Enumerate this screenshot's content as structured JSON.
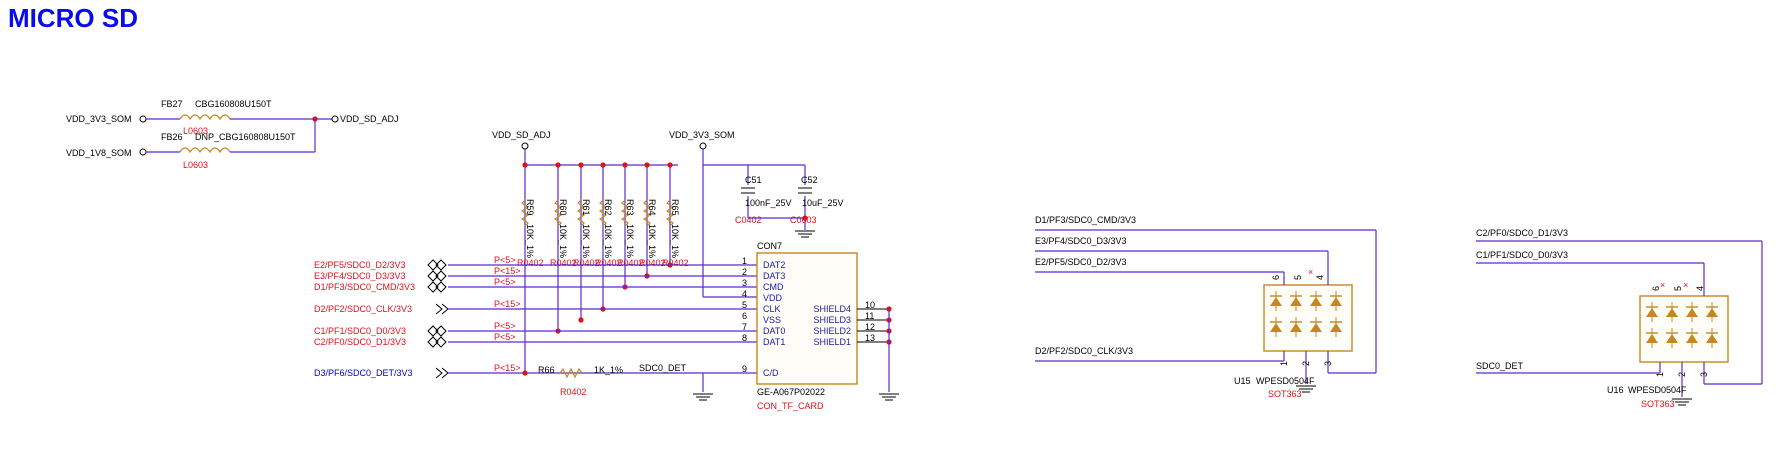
{
  "title": "MICRO SD",
  "ferrites": {
    "fb27": {
      "ref": "FB27",
      "value": "CBG160808U150T",
      "pkg": "L0603"
    },
    "fb26": {
      "ref": "FB26",
      "value": "DNP_CBG160808U150T",
      "pkg": "L0603"
    }
  },
  "power": {
    "vdd_3v3_som": "VDD_3V3_SOM",
    "vdd_1v8_som": "VDD_1V8_SOM",
    "vdd_sd_adj": "VDD_SD_ADJ",
    "vdd_sd_adj_top": "VDD_SD_ADJ",
    "vdd_3v3_som_top": "VDD_3V3_SOM"
  },
  "resistors": [
    {
      "ref": "R59",
      "value": "10K_1%",
      "pkg": "R0402"
    },
    {
      "ref": "R60",
      "value": "10K_1%",
      "pkg": "R0402"
    },
    {
      "ref": "R61",
      "value": "10K_1%",
      "pkg": "R0402"
    },
    {
      "ref": "R62",
      "value": "10K_1%",
      "pkg": "R0402"
    },
    {
      "ref": "R63",
      "value": "10K_1%",
      "pkg": "R0402"
    },
    {
      "ref": "R64",
      "value": "10K_1%",
      "pkg": "R0402"
    },
    {
      "ref": "R65",
      "value": "10K_1%",
      "pkg": "R0402"
    }
  ],
  "caps": [
    {
      "ref": "C51",
      "value": "100nF_25V",
      "pkg": "C0402"
    },
    {
      "ref": "C52",
      "value": "10uF_25V",
      "pkg": "C0603"
    }
  ],
  "ports": [
    {
      "net": "E2/PF5/SDC0_D2/3V3",
      "xref": "P<5>"
    },
    {
      "net": "E3/PF4/SDC0_D3/3V3",
      "xref": "P<15>"
    },
    {
      "net": "D1/PF3/SDC0_CMD/3V3",
      "xref": "P<5>"
    },
    {
      "net": "D2/PF2/SDC0_CLK/3V3",
      "xref": "P<15>"
    },
    {
      "net": "C1/PF1/SDC0_D0/3V3",
      "xref": "P<5>"
    },
    {
      "net": "C2/PF0/SDC0_D1/3V3",
      "xref": "P<5>"
    },
    {
      "net": "D3/PF6/SDC0_DET/3V3",
      "xref": "P<15>"
    }
  ],
  "r66": {
    "ref": "R66",
    "value": "1K_1%",
    "pkg": "R0402",
    "net": "SDC0_DET"
  },
  "connector": {
    "ref": "CON7",
    "part": "GE-A067P02022",
    "name": "CON_TF_CARD",
    "left_pins": [
      {
        "num": "1",
        "name": "DAT2"
      },
      {
        "num": "2",
        "name": "DAT3"
      },
      {
        "num": "3",
        "name": "CMD"
      },
      {
        "num": "4",
        "name": "VDD"
      },
      {
        "num": "5",
        "name": "CLK"
      },
      {
        "num": "6",
        "name": "VSS"
      },
      {
        "num": "7",
        "name": "DAT0"
      },
      {
        "num": "8",
        "name": "DAT1"
      },
      {
        "num": "9",
        "name": "C/D"
      }
    ],
    "right_pins": [
      {
        "num": "10",
        "name": "SHIELD4"
      },
      {
        "num": "11",
        "name": "SHIELD3"
      },
      {
        "num": "12",
        "name": "SHIELD2"
      },
      {
        "num": "13",
        "name": "SHIELD1"
      }
    ]
  },
  "u15": {
    "ref": "U15",
    "part": "WPESD0504F",
    "pkg": "SOT363",
    "nets": [
      "D1/PF3/SDC0_CMD/3V3",
      "E3/PF4/SDC0_D3/3V3",
      "E2/PF5/SDC0_D2/3V3",
      "D2/PF2/SDC0_CLK/3V3"
    ],
    "pins": {
      "p6": "6",
      "p5": "5",
      "p4": "4",
      "p1": "1",
      "p2": "2",
      "p3": "3"
    }
  },
  "u16": {
    "ref": "U16",
    "part": "WPESD0504F",
    "pkg": "SOT363",
    "nets": [
      "C2/PF0/SDC0_D1/3V3",
      "C1/PF1/SDC0_D0/3V3",
      "SDC0_DET"
    ],
    "pins": {
      "p6": "6",
      "p5": "5",
      "p4": "4",
      "p1": "1",
      "p2": "2",
      "p3": "3"
    }
  },
  "colors": {
    "wire": "#5a2bd0",
    "net_red": "#e0101a",
    "net_blue": "#0000c8",
    "component": "#c8861e",
    "title": "#0a0af0"
  }
}
